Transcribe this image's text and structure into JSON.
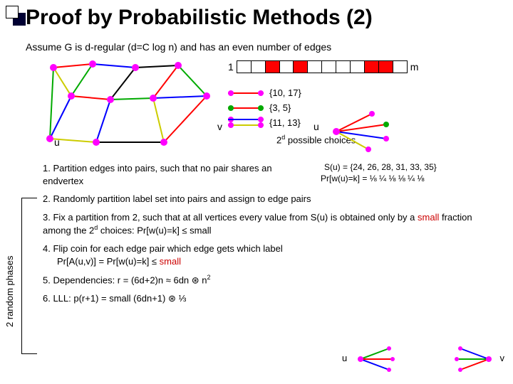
{
  "title": "Proof by Probabilistic Methods (2)",
  "subtitle": "Assume G is d-regular (d=C log n) and has an even number of edges",
  "bar": {
    "one": "1",
    "m": "m"
  },
  "labels": {
    "v": "v",
    "u": "u",
    "u_left": "u",
    "choices_pre": "2",
    "choices_post": " possible choices",
    "choices_sup": "d"
  },
  "sets": {
    "a": "{10, 17}",
    "b": "{3, 5}",
    "c": "{11, 13}"
  },
  "su_line": "S(u) = {24, 26, 28, 31, 33, 35}",
  "prw_line": "Pr[w(u)=k] =  ⅛ ¼ ⅛ ⅛ ¼ ⅛",
  "side": "2 random phases",
  "steps": {
    "s1": "1. Partition edges into pairs, such that no pair shares an endvertex",
    "s2": "2. Randomly partition label set into pairs and assign to edge pairs",
    "s3a": "3. Fix a partition from 2, such that at all vertices every value from S(u) is obtained only by a ",
    "s3b": "small",
    "s3c": " fraction among the 2",
    "s3d": " choices: Pr[w(u)=k] ≤ small",
    "s4a": "4. Flip coin for each edge pair which edge gets which label",
    "s4b": "Pr[A(u,v)] = Pr[w(u)=k] ≤ ",
    "s4c": "small",
    "s5": "5. Dependencies: r = (6d+2)n ≈ 6dn ⊛ n",
    "s5sup": "2",
    "s6": "6. LLL: p(r+1) = small (6dn+1) ⊛ ⅓"
  },
  "bot": {
    "u": "u",
    "v": "v"
  },
  "colors": {
    "red": "#c00",
    "magenta": "#f0f",
    "green": "#0a0",
    "blue": "#00f",
    "yellow": "#cc0"
  }
}
